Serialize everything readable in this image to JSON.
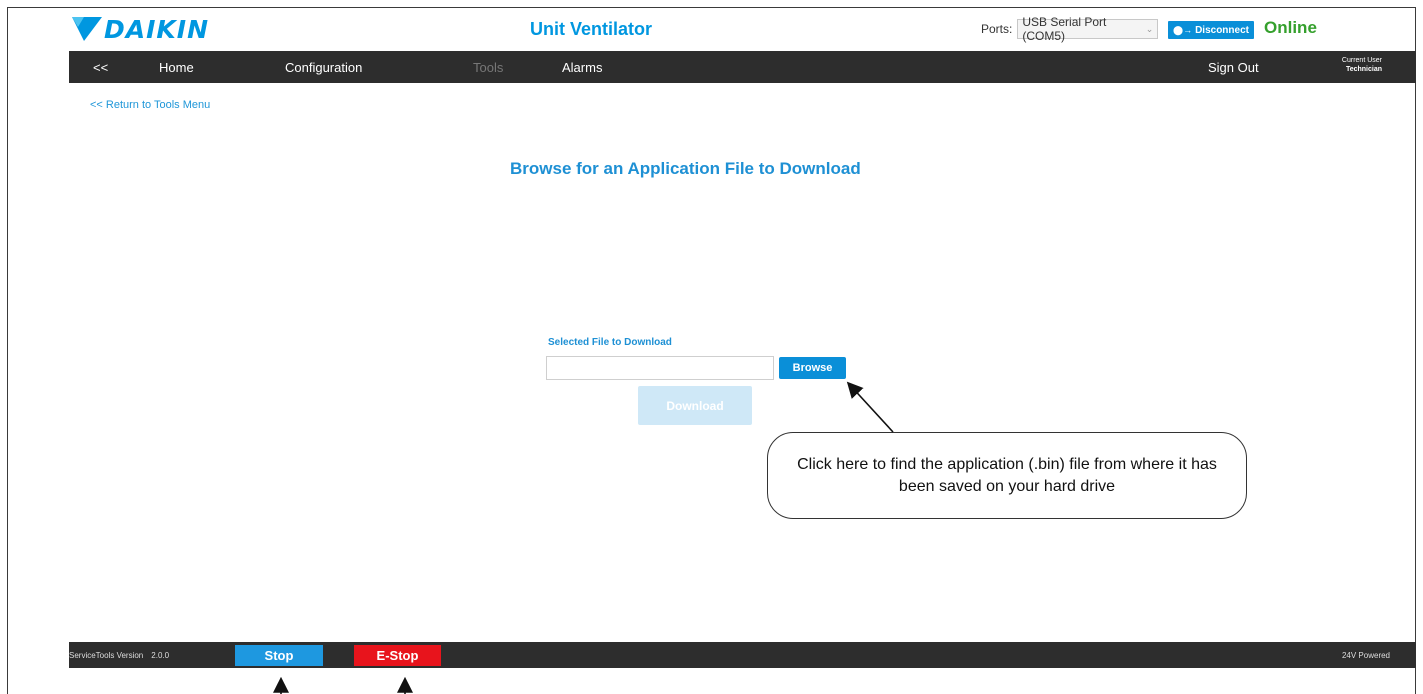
{
  "header": {
    "brand": "DAIKIN",
    "logo_icon": "daikin-logo-mark",
    "app_title": "Unit Ventilator",
    "ports_label": "Ports:",
    "ports_value": "USB Serial Port (COM5)",
    "disconnect_label": "Disconnect",
    "status_text": "Online",
    "colors": {
      "brand": "#0097e0",
      "status_online": "#35a02d",
      "button_primary": "#0a8fd8",
      "nav_background": "#2d2d2d"
    }
  },
  "nav": {
    "back_label": "<<",
    "items": [
      {
        "label": "Home",
        "enabled": true
      },
      {
        "label": "Configuration",
        "enabled": true
      },
      {
        "label": "Tools",
        "enabled": false
      },
      {
        "label": "Alarms",
        "enabled": true
      }
    ],
    "sign_out_label": "Sign Out",
    "current_user_caption": "Current User",
    "current_user_name": "Technician"
  },
  "main": {
    "return_link": "<< Return to Tools Menu",
    "heading": "Browse for an Application File to Download",
    "field_label": "Selected File to Download",
    "file_value": "",
    "browse_label": "Browse",
    "download_label": "Download",
    "callout_text": "Click here to find the application (.bin) file from where it has been saved on your hard drive"
  },
  "footer": {
    "version_label": "ServiceTools Version",
    "version_number": "2.0.0",
    "stop_label": "Stop",
    "estop_label": "E-Stop",
    "power_text": "24V Powered",
    "colors": {
      "stop": "#1e98e0",
      "estop": "#e8141c"
    }
  }
}
